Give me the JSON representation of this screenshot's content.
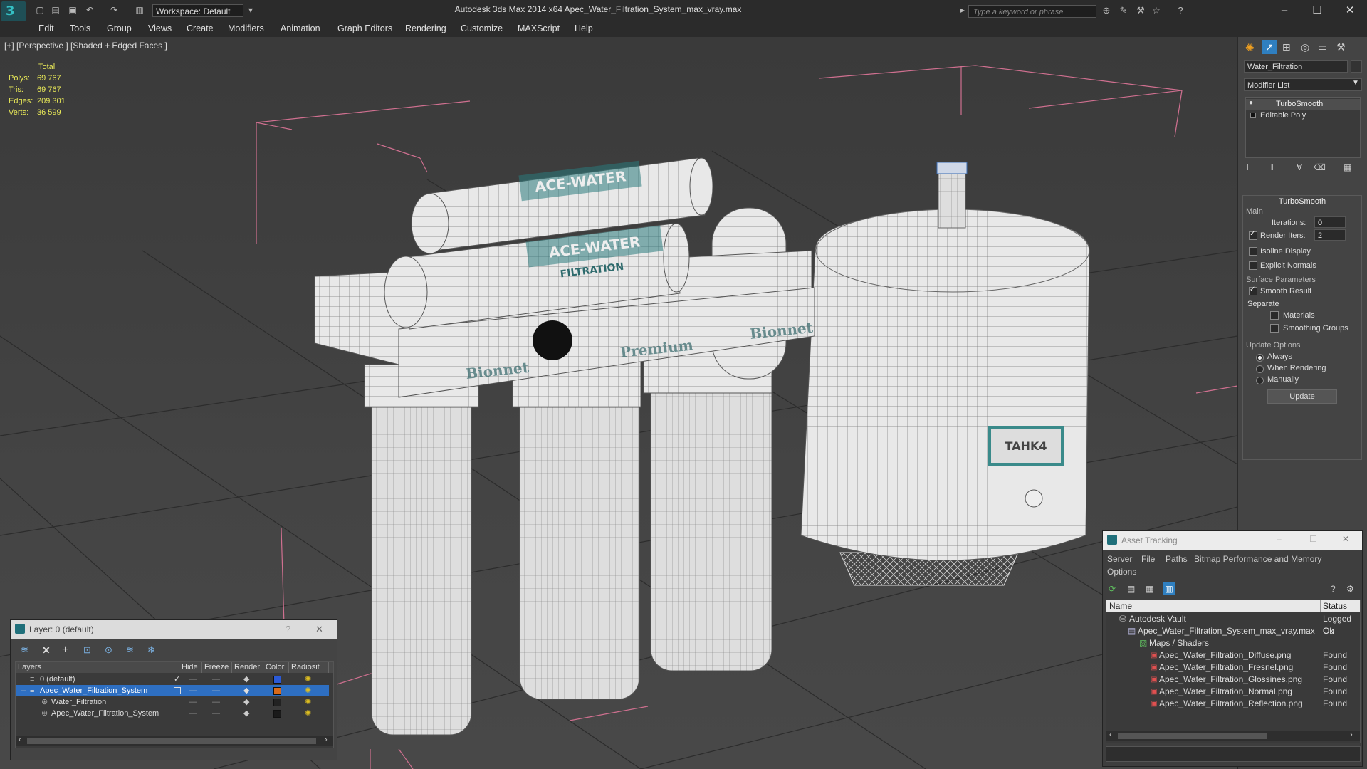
{
  "app": {
    "title": "Autodesk 3ds Max  2014 x64      Apec_Water_Filtration_System_max_vray.max",
    "logo": "3",
    "workspace": "Workspace: Default",
    "search_placeholder": "Type a keyword or phrase"
  },
  "menu": [
    "Edit",
    "Tools",
    "Group",
    "Views",
    "Create",
    "Modifiers",
    "Animation",
    "Graph Editors",
    "Rendering",
    "Customize",
    "MAXScript",
    "Help"
  ],
  "viewport": {
    "label": "[+] [Perspective ] [Shaded + Edged Faces ]",
    "stats": {
      "header": "Total",
      "rows": [
        {
          "k": "Polys:",
          "v": "69 767"
        },
        {
          "k": "Tris:",
          "v": "69 767"
        },
        {
          "k": "Edges:",
          "v": "209 301"
        },
        {
          "k": "Verts:",
          "v": "36 599"
        }
      ]
    },
    "labels": {
      "tank": "TAHK4",
      "filter_top": "ACE-WATER",
      "filter_mid": "ACE-WATER",
      "filter_sub": "FILTRATION",
      "bracket_left": "Bionnet",
      "bracket_mid": "Premium",
      "bracket_right": "Bionnet"
    }
  },
  "command_panel": {
    "object_name": "Water_Filtration",
    "modifier_list": "Modifier List",
    "stack": [
      "TurboSmooth",
      "Editable Poly"
    ],
    "rollout_title": "TurboSmooth",
    "main_label": "Main",
    "iterations_label": "Iterations:",
    "iterations_value": "0",
    "render_iters_label": "Render Iters:",
    "render_iters_value": "2",
    "isoline": "Isoline Display",
    "explicit": "Explicit Normals",
    "surface_params": "Surface Parameters",
    "smooth_result": "Smooth Result",
    "separate": "Separate",
    "materials": "Materials",
    "smoothing_groups": "Smoothing Groups",
    "update_options": "Update Options",
    "always": "Always",
    "when_rendering": "When Rendering",
    "manually": "Manually",
    "update_button": "Update"
  },
  "layer_dialog": {
    "title": "Layer: 0 (default)",
    "help": "?",
    "close": "✕",
    "columns": [
      "Layers",
      "Hide",
      "Freeze",
      "Render",
      "Color",
      "Radiosit"
    ],
    "rows": [
      {
        "name": "0 (default)",
        "color": "#2a5ad8"
      },
      {
        "name": "Apec_Water_Filtration_System",
        "color": "#d86a1a"
      },
      {
        "name": "Water_Filtration",
        "color": "#222222"
      },
      {
        "name": "Apec_Water_Filtration_System",
        "color": "#1a1a1a"
      }
    ]
  },
  "asset_tracking": {
    "title": "Asset Tracking",
    "menu": [
      "Server",
      "File",
      "Paths",
      "Bitmap Performance and Memory",
      "Options"
    ],
    "columns": [
      "Name",
      "Status"
    ],
    "rows": [
      {
        "name": "Autodesk Vault",
        "status": "Logged Ou"
      },
      {
        "name": "Apec_Water_Filtration_System_max_vray.max",
        "status": "Ok"
      },
      {
        "name": "Maps / Shaders",
        "status": ""
      },
      {
        "name": "Apec_Water_Filtration_Diffuse.png",
        "status": "Found"
      },
      {
        "name": "Apec_Water_Filtration_Fresnel.png",
        "status": "Found"
      },
      {
        "name": "Apec_Water_Filtration_Glossines.png",
        "status": "Found"
      },
      {
        "name": "Apec_Water_Filtration_Normal.png",
        "status": "Found"
      },
      {
        "name": "Apec_Water_Filtration_Reflection.png",
        "status": "Found"
      }
    ]
  }
}
